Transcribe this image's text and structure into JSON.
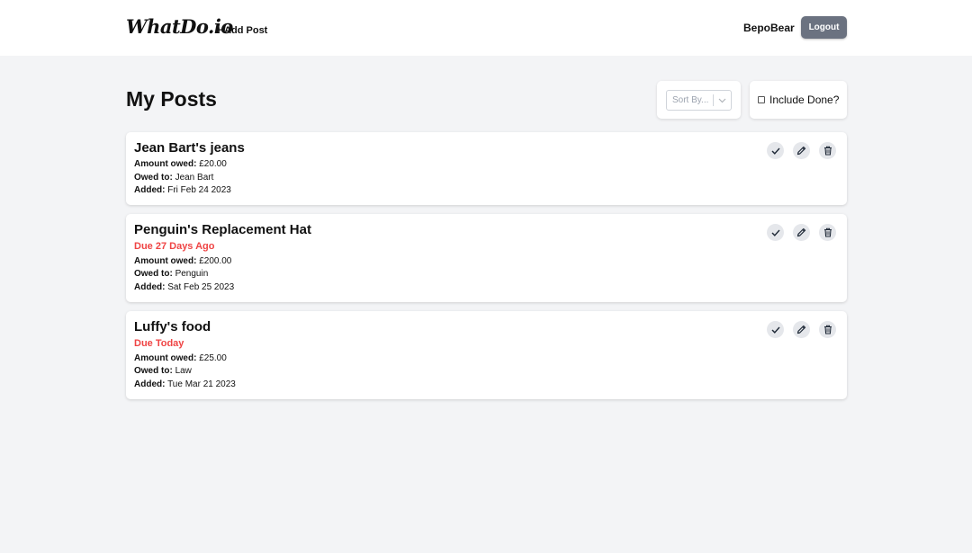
{
  "header": {
    "logo": "WhatDo.io",
    "add_post": "+ Add Post",
    "username": "BepoBear",
    "logout": "Logout"
  },
  "page": {
    "title": "My Posts"
  },
  "controls": {
    "sort_placeholder": "Sort By...",
    "include_done_label": "Include Done?",
    "include_done_checked": false
  },
  "labels": {
    "amount": "Amount owed:",
    "owed_to": "Owed to:",
    "added": "Added:"
  },
  "posts": [
    {
      "title": "Jean Bart's jeans",
      "due": "",
      "amount": "£20.00",
      "owed_to": "Jean Bart",
      "added": "Fri Feb 24 2023"
    },
    {
      "title": "Penguin's Replacement Hat",
      "due": "Due 27 Days Ago",
      "amount": "£200.00",
      "owed_to": "Penguin",
      "added": "Sat Feb 25 2023"
    },
    {
      "title": "Luffy's food",
      "due": "Due Today",
      "amount": "£25.00",
      "owed_to": "Law",
      "added": "Tue Mar 21 2023"
    }
  ],
  "colors": {
    "background": "#f3f4f6",
    "due_text": "#ef4444",
    "logout_button": "#6b7280",
    "icon_button_bg": "#e5e7eb"
  },
  "icons": {
    "done": "check-icon",
    "edit": "pencil-icon",
    "delete": "trash-icon",
    "sort": "chevron-down-icon"
  }
}
